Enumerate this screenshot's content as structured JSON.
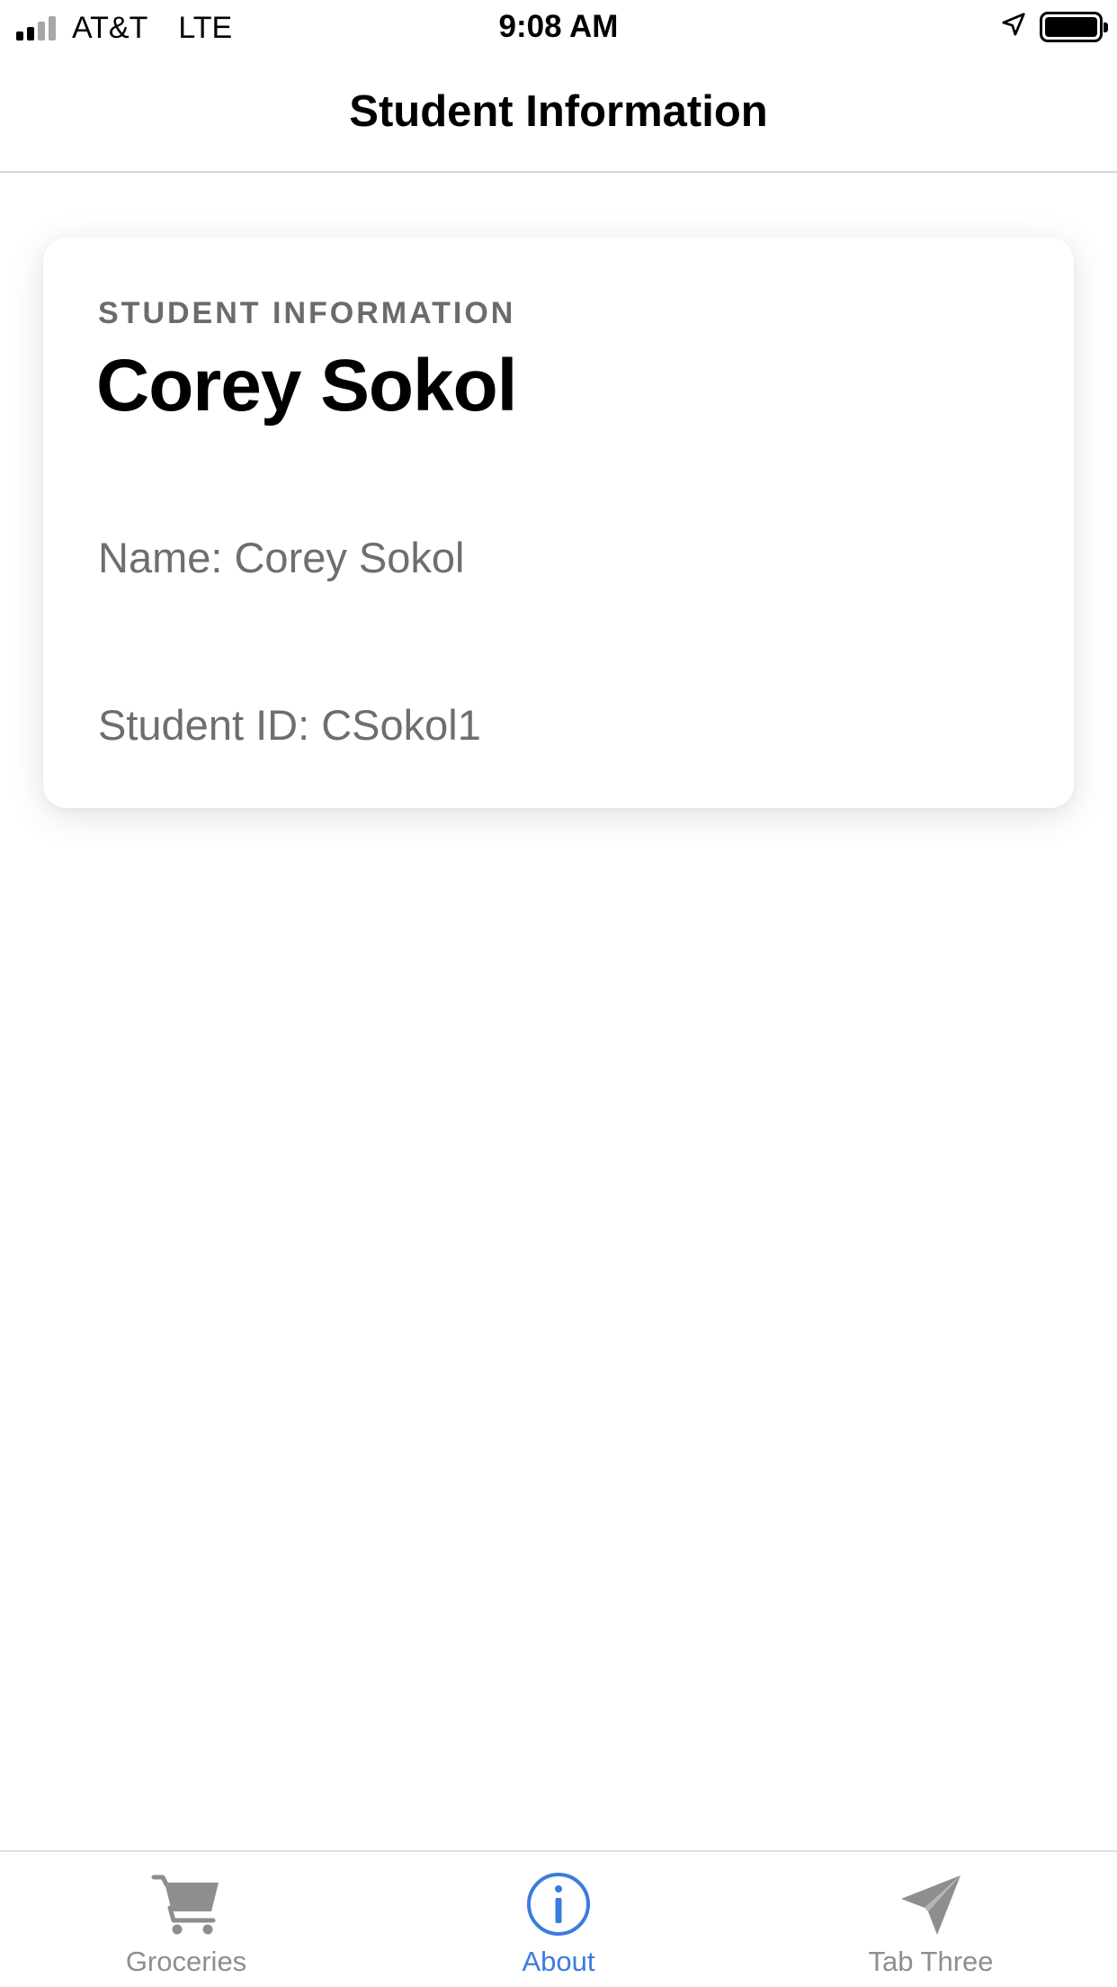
{
  "status_bar": {
    "carrier": "AT&T",
    "network": "LTE",
    "time": "9:08 AM",
    "signal_bars_filled": 2,
    "signal_bars_total": 4
  },
  "nav_bar": {
    "title": "Student Information"
  },
  "card": {
    "eyebrow": "STUDENT INFORMATION",
    "heading": "Corey Sokol",
    "name_line": "Name: Corey Sokol",
    "id_line": "Student ID: CSokol1"
  },
  "tab_bar": {
    "tabs": [
      {
        "label": "Groceries",
        "icon": "cart-icon",
        "active": false
      },
      {
        "label": "About",
        "icon": "info-icon",
        "active": true
      },
      {
        "label": "Tab Three",
        "icon": "paper-plane-icon",
        "active": false
      }
    ],
    "active_color": "#3b7be0",
    "inactive_color": "#8e8e8e"
  }
}
